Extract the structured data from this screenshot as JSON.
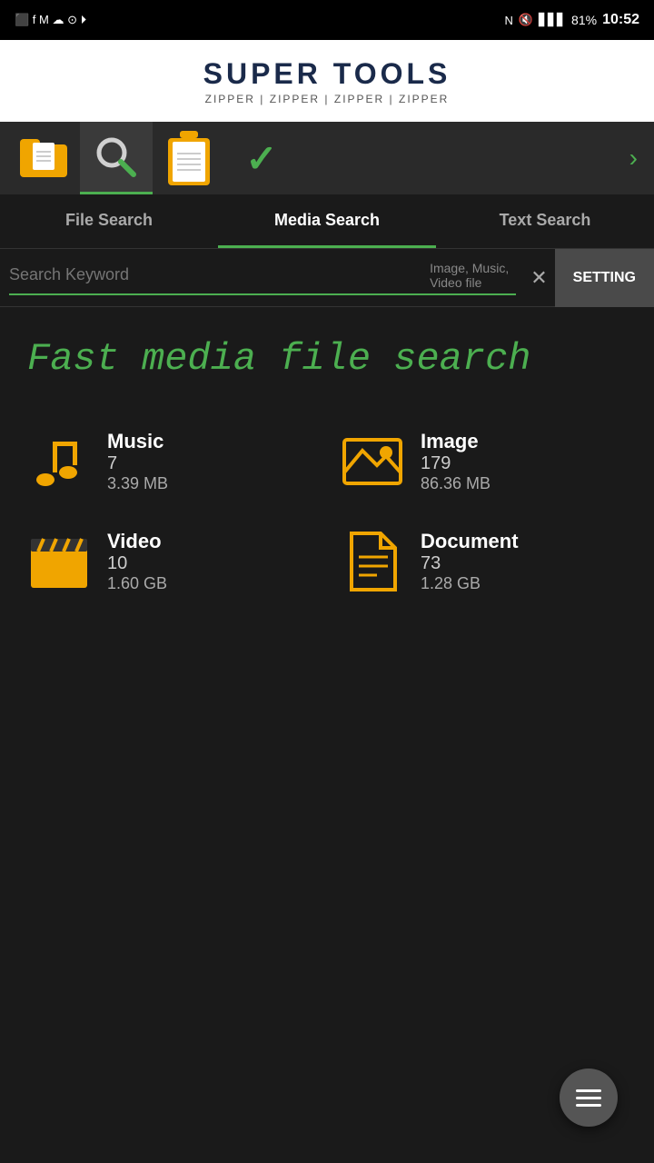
{
  "statusBar": {
    "time": "10:52",
    "battery": "81%",
    "signal": "▋▋▋"
  },
  "banner": {
    "title": "SUPER TOOLS",
    "subtitle": "ZIPPER | ZIPPER | ZIPPER | ZIPPER"
  },
  "toolbar": {
    "buttons": [
      {
        "id": "folder",
        "label": "Folder"
      },
      {
        "id": "search",
        "label": "Search",
        "active": true
      },
      {
        "id": "clipboard",
        "label": "Clipboard"
      },
      {
        "id": "check",
        "label": "Check"
      }
    ],
    "more_arrow": "›"
  },
  "tabs": [
    {
      "id": "file-search",
      "label": "File Search"
    },
    {
      "id": "media-search",
      "label": "Media Search",
      "active": true
    },
    {
      "id": "text-search",
      "label": "Text Search"
    }
  ],
  "searchBar": {
    "placeholder": "Search Keyword",
    "hint": "Image, Music,\nVideo file",
    "settingLabel": "SETTING"
  },
  "headline": "Fast media file search",
  "stats": [
    {
      "id": "music",
      "label": "Music",
      "count": "7",
      "size": "3.39 MB"
    },
    {
      "id": "image",
      "label": "Image",
      "count": "179",
      "size": "86.36 MB"
    },
    {
      "id": "video",
      "label": "Video",
      "count": "10",
      "size": "1.60 GB"
    },
    {
      "id": "document",
      "label": "Document",
      "count": "73",
      "size": "1.28 GB"
    }
  ],
  "fab": {
    "label": "Menu"
  }
}
